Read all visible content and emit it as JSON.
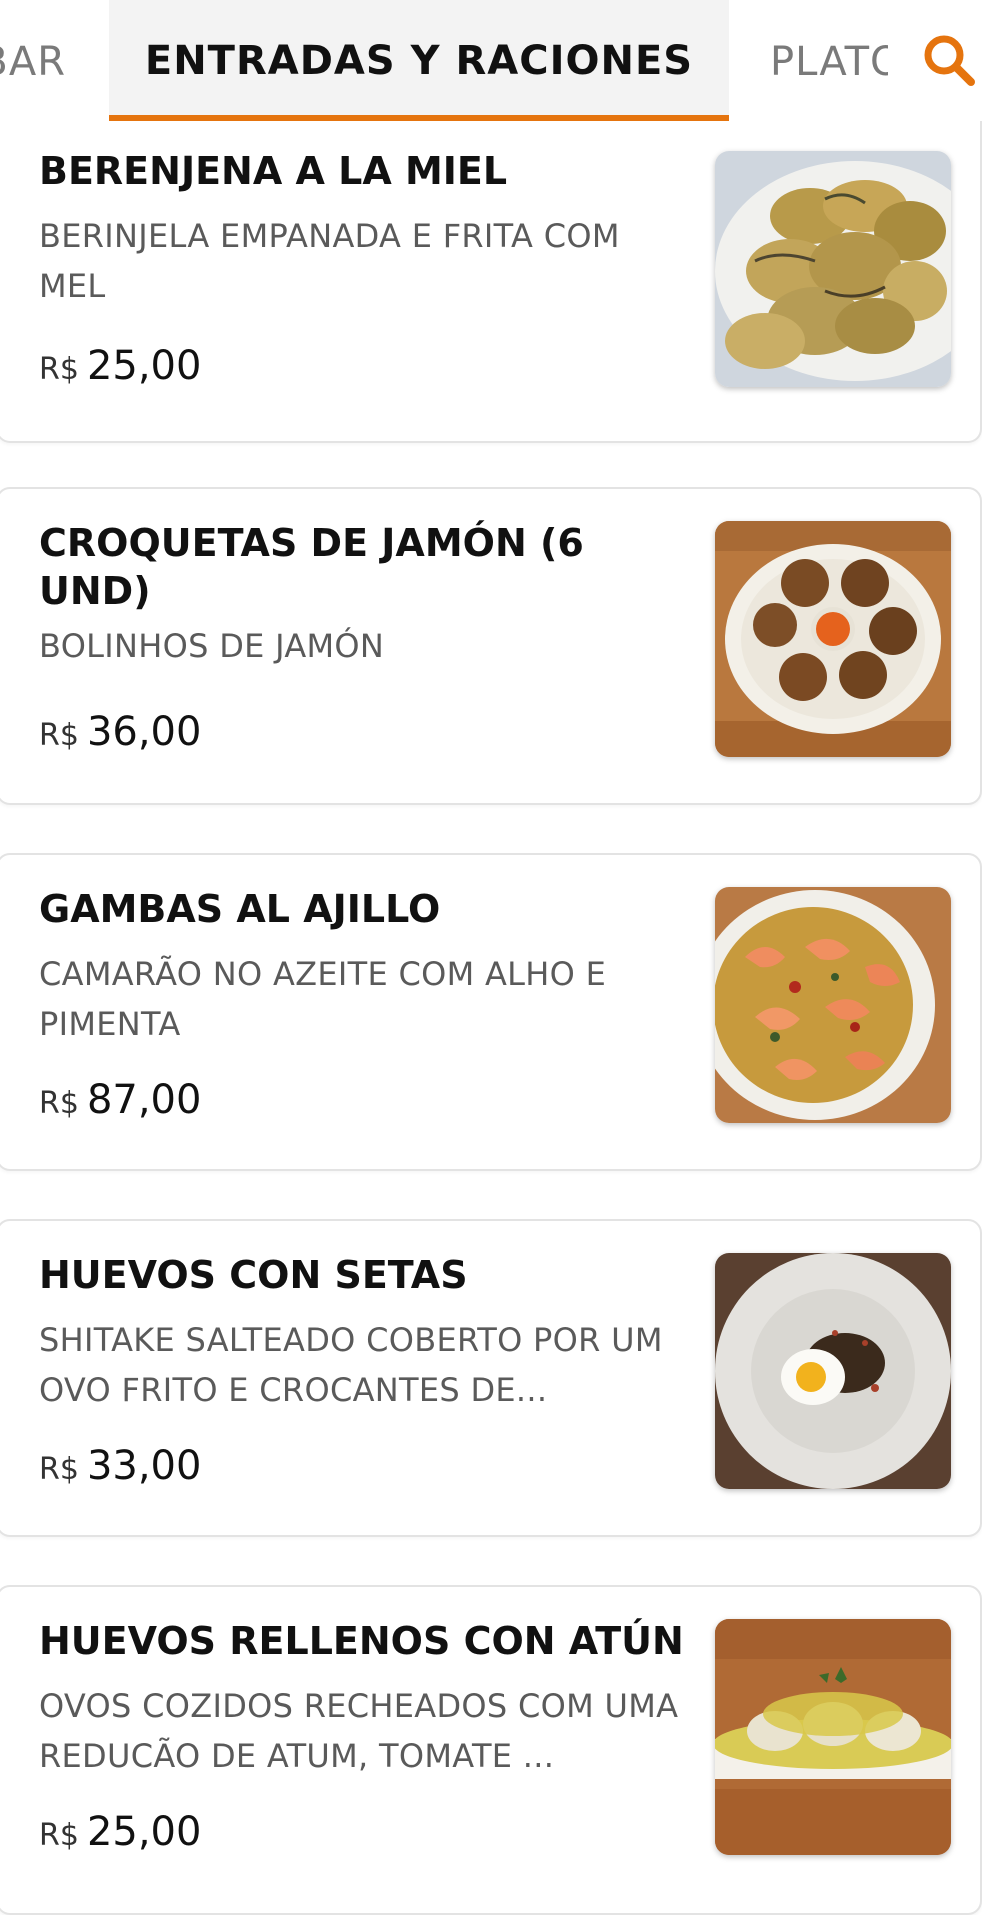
{
  "tabs": {
    "previous_label": "BAR",
    "active_label": "ENTRADAS Y RACIONES",
    "next_label": "PLATOS"
  },
  "accent_color": "#e5740e",
  "search": {
    "icon": "search-icon"
  },
  "items": [
    {
      "name": "BERENJENA A LA MIEL",
      "description": "BERINJELA EMPANADA E FRITA COM MEL",
      "currency": "R$",
      "price": "25,00",
      "image_icon": "fried-eggplant-photo"
    },
    {
      "name": "CROQUETAS DE JAMÓN (6 UND)",
      "description": "BOLINHOS DE JAMÓN",
      "currency": "R$",
      "price": "36,00",
      "image_icon": "croquettes-photo"
    },
    {
      "name": "GAMBAS AL AJILLO",
      "description": "CAMARÃO NO AZEITE COM ALHO E PIMENTA",
      "currency": "R$",
      "price": "87,00",
      "image_icon": "shrimp-photo"
    },
    {
      "name": "HUEVOS CON SETAS",
      "description": "SHITAKE SALTEADO COBERTO POR UM OVO FRITO E CROCANTES DE...",
      "currency": "R$",
      "price": "33,00",
      "image_icon": "egg-mushrooms-photo"
    },
    {
      "name": "HUEVOS RELLENOS CON ATÚN",
      "description": "OVOS COZIDOS RECHEADOS COM UMA REDUCÃO DE ATUM, TOMATE ...",
      "currency": "R$",
      "price": "25,00",
      "image_icon": "stuffed-eggs-photo"
    }
  ]
}
